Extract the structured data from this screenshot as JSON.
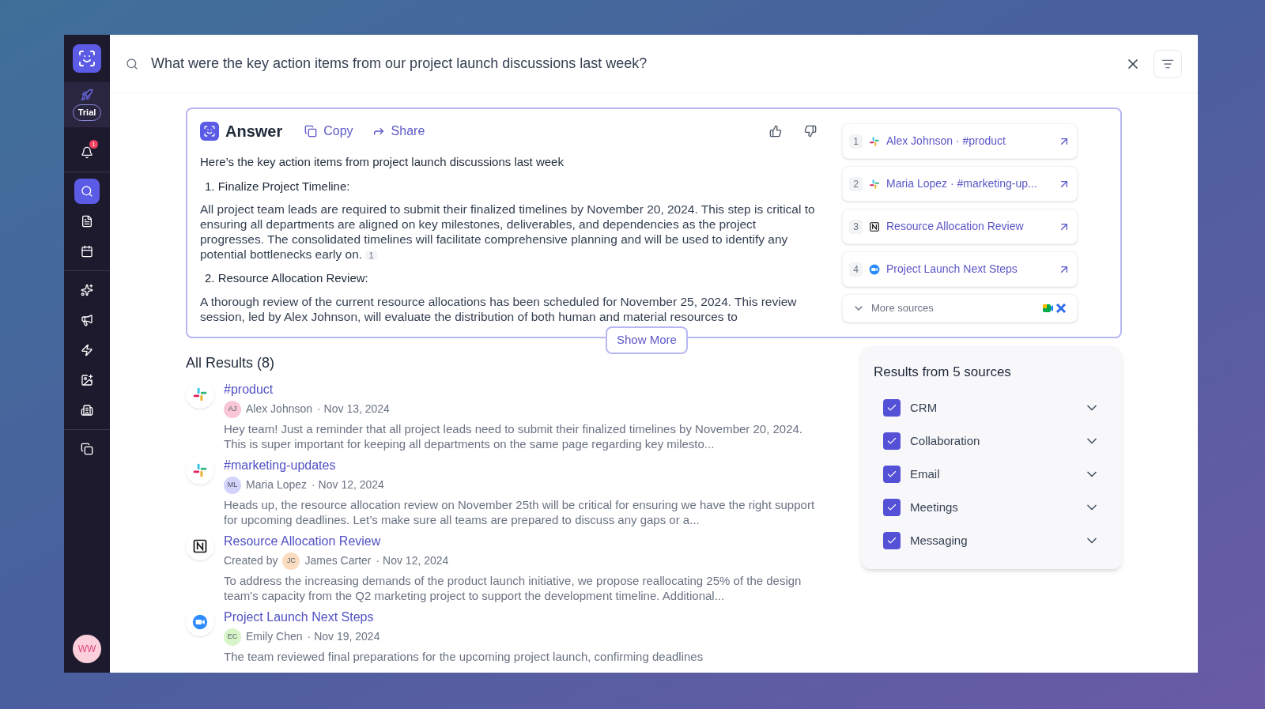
{
  "sidebar": {
    "trial_badge": "Trial",
    "groups": [
      [
        {
          "kind": "bell",
          "selected": false,
          "badge": "1"
        }
      ],
      [
        {
          "kind": "search",
          "selected": true
        },
        {
          "kind": "document",
          "selected": false
        },
        {
          "kind": "calendar",
          "selected": false
        }
      ],
      [
        {
          "kind": "sparkles",
          "selected": false
        },
        {
          "kind": "megaphone",
          "selected": false
        },
        {
          "kind": "bolt",
          "selected": false
        },
        {
          "kind": "image",
          "selected": false
        },
        {
          "kind": "building",
          "selected": false
        }
      ],
      [
        {
          "kind": "copy",
          "selected": false
        }
      ]
    ],
    "avatar": "WW"
  },
  "search": {
    "value": "What were the key action items from our project launch discussions last week?"
  },
  "answer": {
    "title": "Answer",
    "copy": "Copy",
    "share": "Share",
    "intro": "Here’s the key action items from project launch discussions last week",
    "sections": [
      {
        "heading": "1. Finalize Project Timeline:",
        "body": "All project team leads are required to submit their finalized timelines by November 20, 2024. This step is critical to ensuring all departments are aligned on key milestones, deliverables, and dependencies as the project progresses. The consolidated timelines will facilitate comprehensive planning and will be used to identify any potential bottlenecks early on.",
        "citation": "1"
      },
      {
        "heading": "2. Resource Allocation Review:",
        "body": "A thorough review of the current resource allocations has been scheduled for November 25, 2024. This review session, led by Alex Johnson, will evaluate the distribution of both human and material resources to"
      }
    ],
    "show_more": "Show More",
    "sources": [
      {
        "number": "1",
        "kind": "slack",
        "label": "Alex Johnson · #product"
      },
      {
        "number": "2",
        "kind": "slack",
        "label": "Maria Lopez · #marketing-up..."
      },
      {
        "number": "3",
        "kind": "notion",
        "label": "Resource Allocation Review"
      },
      {
        "number": "4",
        "kind": "zoom",
        "label": "Project Launch Next Steps"
      }
    ],
    "more_sources": "More sources"
  },
  "results": {
    "title": "All Results (8)",
    "items": [
      {
        "kind": "slack",
        "title": "#product",
        "initials": "AJ",
        "color": "#f9c6d8",
        "author": "Alex Johnson",
        "date": "· Nov 13, 2024",
        "snippet": "Hey team! Just a reminder that all project leads need to submit their finalized timelines by November 20, 2024. This is super important for keeping all departments on the same page regarding key milesto..."
      },
      {
        "kind": "slack",
        "title": "#marketing-updates",
        "initials": "ML",
        "color": "#d4d3fb",
        "author": "Maria Lopez",
        "date": "· Nov 12, 2024",
        "snippet": "Heads up, the resource allocation review on November 25th will be critical for ensuring we have the right support for upcoming deadlines. Let’s make sure all teams are prepared to discuss any gaps or a..."
      },
      {
        "kind": "notion",
        "title": "Resource Allocation Review",
        "prefix": "Created by",
        "initials": "JC",
        "color": "#fbdcc0",
        "author": "James Carter",
        "date": "· Nov 12, 2024",
        "snippet": "To address the increasing demands of the product launch initiative, we propose reallocating 25% of the design team's capacity from the Q2 marketing project to support the development timeline. Additional..."
      },
      {
        "kind": "zoom",
        "title": "Project Launch Next Steps",
        "initials": "EC",
        "color": "#d7f5c8",
        "author": "Emily Chen",
        "date": "· Nov 19, 2024",
        "snippet": "The team reviewed final preparations for the upcoming project launch, confirming deadlines"
      }
    ]
  },
  "filters": {
    "title": "Results from 5 sources",
    "items": [
      {
        "label": "CRM",
        "checked": true
      },
      {
        "label": "Collaboration",
        "checked": true
      },
      {
        "label": "Email",
        "checked": true
      },
      {
        "label": "Meetings",
        "checked": true
      },
      {
        "label": "Messaging",
        "checked": true
      }
    ]
  }
}
